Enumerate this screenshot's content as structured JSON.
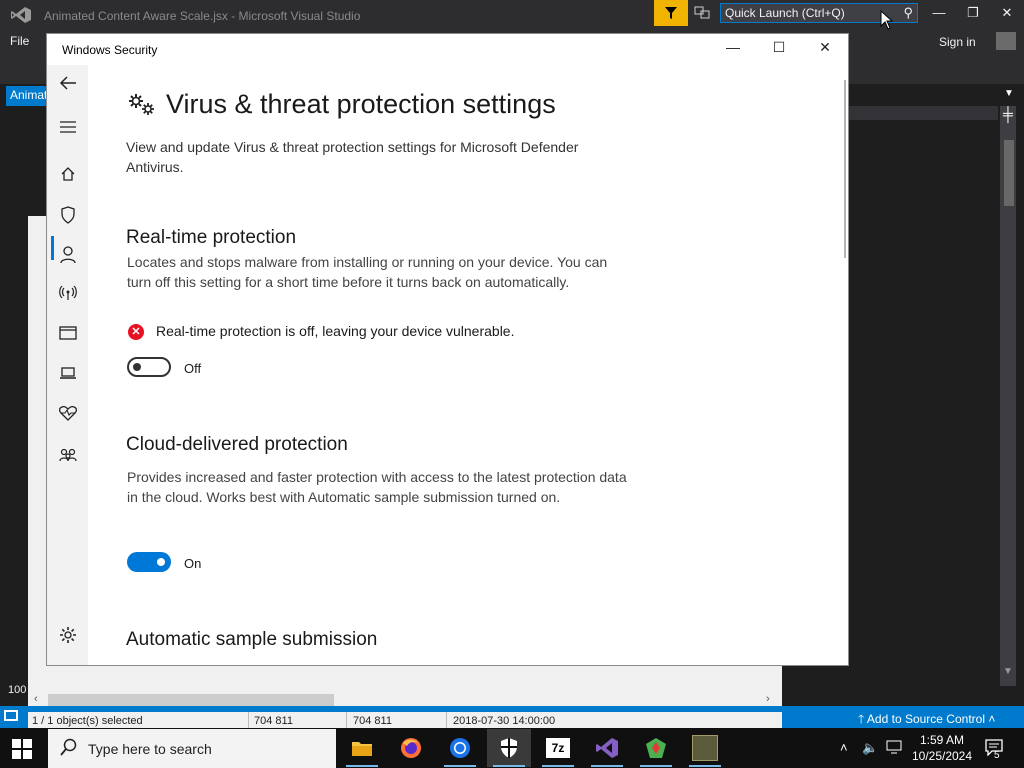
{
  "vs": {
    "title": "Animated Content Aware Scale.jsx - Microsoft Visual Studio",
    "quick_launch": "Quick Launch (Ctrl+Q)",
    "menu_file": "File",
    "sign_in": "Sign in",
    "tab": "Animat",
    "zoom": "100",
    "add_to_source": "Add to Source Control"
  },
  "explorer": {
    "selected": "1 / 1 object(s) selected",
    "size1": "704 811",
    "size2": "704 811",
    "date": "2018-07-30 14:00:00"
  },
  "security": {
    "window_title": "Windows Security",
    "heading": "Virus & threat protection settings",
    "description": "View and update Virus & threat protection settings for Microsoft Defender Antivirus.",
    "realtime": {
      "title": "Real-time protection",
      "text": "Locates and stops malware from installing or running on your device. You can turn off this setting for a short time before it turns back on automatically.",
      "warning": "Real-time protection is off, leaving your device vulnerable.",
      "toggle_label": "Off",
      "toggle_on": false
    },
    "cloud": {
      "title": "Cloud-delivered protection",
      "text": "Provides increased and faster protection with access to the latest protection data in the cloud. Works best with Automatic sample submission turned on.",
      "toggle_label": "On",
      "toggle_on": true
    },
    "sample": {
      "title": "Automatic sample submission"
    },
    "accent": "#0078d7",
    "error_color": "#e81123"
  },
  "taskbar": {
    "search_placeholder": "Type here to search",
    "time": "1:59 AM",
    "date": "10/25/2024",
    "notification_count": "5",
    "archive_app_label": "7z"
  }
}
